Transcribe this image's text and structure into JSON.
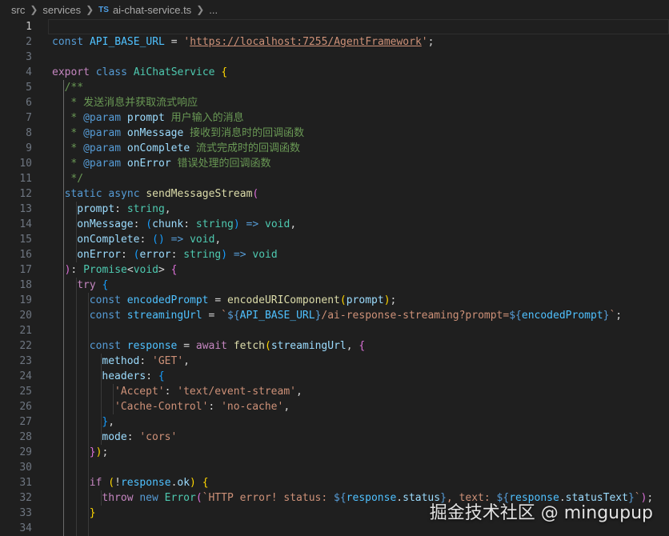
{
  "breadcrumb": {
    "items": [
      "src",
      "services"
    ],
    "file_icon": "TS",
    "file_name": "ai-chat-service.ts",
    "ellipsis": "..."
  },
  "editor": {
    "current_line": 1,
    "lines": [
      {
        "n": "1",
        "indent": 0,
        "tokens": []
      },
      {
        "n": "2",
        "indent": 0,
        "tokens": [
          [
            "kw",
            "const "
          ],
          [
            "cst",
            "API_BASE_URL"
          ],
          [
            "op",
            " = "
          ],
          [
            "str",
            "'"
          ],
          [
            "str link",
            "https://localhost:7255/AgentFramework"
          ],
          [
            "str",
            "'"
          ],
          [
            "pl",
            ";"
          ]
        ]
      },
      {
        "n": "3",
        "indent": 0,
        "tokens": []
      },
      {
        "n": "4",
        "indent": 0,
        "tokens": [
          [
            "ctl",
            "export "
          ],
          [
            "kw",
            "class "
          ],
          [
            "typ",
            "AiChatService "
          ],
          [
            "b1",
            "{"
          ]
        ]
      },
      {
        "n": "5",
        "indent": 1,
        "tokens": [
          [
            "cmt",
            "/**"
          ]
        ]
      },
      {
        "n": "6",
        "indent": 1,
        "tokens": [
          [
            "cmt",
            " * 发送消息并获取流式响应"
          ]
        ]
      },
      {
        "n": "7",
        "indent": 1,
        "tokens": [
          [
            "cmt",
            " * "
          ],
          [
            "kw",
            "@param "
          ],
          [
            "var",
            "prompt "
          ],
          [
            "cmt",
            "用户输入的消息"
          ]
        ]
      },
      {
        "n": "8",
        "indent": 1,
        "tokens": [
          [
            "cmt",
            " * "
          ],
          [
            "kw",
            "@param "
          ],
          [
            "var",
            "onMessage "
          ],
          [
            "cmt",
            "接收到消息时的回调函数"
          ]
        ]
      },
      {
        "n": "9",
        "indent": 1,
        "tokens": [
          [
            "cmt",
            " * "
          ],
          [
            "kw",
            "@param "
          ],
          [
            "var",
            "onComplete "
          ],
          [
            "cmt",
            "流式完成时的回调函数"
          ]
        ]
      },
      {
        "n": "10",
        "indent": 1,
        "tokens": [
          [
            "cmt",
            " * "
          ],
          [
            "kw",
            "@param "
          ],
          [
            "var",
            "onError "
          ],
          [
            "cmt",
            "错误处理的回调函数"
          ]
        ]
      },
      {
        "n": "11",
        "indent": 1,
        "tokens": [
          [
            "cmt",
            " */"
          ]
        ]
      },
      {
        "n": "12",
        "indent": 1,
        "tokens": [
          [
            "kw",
            "static "
          ],
          [
            "kw",
            "async "
          ],
          [
            "fn",
            "sendMessageStream"
          ],
          [
            "b2",
            "("
          ]
        ]
      },
      {
        "n": "13",
        "indent": 2,
        "tokens": [
          [
            "var",
            "prompt"
          ],
          [
            "pl",
            ": "
          ],
          [
            "typ",
            "string"
          ],
          [
            "pl",
            ","
          ]
        ]
      },
      {
        "n": "14",
        "indent": 2,
        "tokens": [
          [
            "var",
            "onMessage"
          ],
          [
            "pl",
            ": "
          ],
          [
            "b3",
            "("
          ],
          [
            "var",
            "chunk"
          ],
          [
            "pl",
            ": "
          ],
          [
            "typ",
            "string"
          ],
          [
            "b3",
            ")"
          ],
          [
            "kw",
            " => "
          ],
          [
            "typ",
            "void"
          ],
          [
            "pl",
            ","
          ]
        ]
      },
      {
        "n": "15",
        "indent": 2,
        "tokens": [
          [
            "var",
            "onComplete"
          ],
          [
            "pl",
            ": "
          ],
          [
            "b3",
            "()"
          ],
          [
            "kw",
            " => "
          ],
          [
            "typ",
            "void"
          ],
          [
            "pl",
            ","
          ]
        ]
      },
      {
        "n": "16",
        "indent": 2,
        "tokens": [
          [
            "var",
            "onError"
          ],
          [
            "pl",
            ": "
          ],
          [
            "b3",
            "("
          ],
          [
            "var",
            "error"
          ],
          [
            "pl",
            ": "
          ],
          [
            "typ",
            "string"
          ],
          [
            "b3",
            ")"
          ],
          [
            "kw",
            " => "
          ],
          [
            "typ",
            "void"
          ]
        ]
      },
      {
        "n": "17",
        "indent": 1,
        "tokens": [
          [
            "b2",
            ")"
          ],
          [
            "pl",
            ": "
          ],
          [
            "typ",
            "Promise"
          ],
          [
            "pl",
            "<"
          ],
          [
            "typ",
            "void"
          ],
          [
            "pl",
            "> "
          ],
          [
            "b2",
            "{"
          ]
        ]
      },
      {
        "n": "18",
        "indent": 2,
        "tokens": [
          [
            "ctl",
            "try "
          ],
          [
            "b3",
            "{"
          ]
        ]
      },
      {
        "n": "19",
        "indent": 3,
        "tokens": [
          [
            "kw",
            "const "
          ],
          [
            "cst",
            "encodedPrompt"
          ],
          [
            "op",
            " = "
          ],
          [
            "fn",
            "encodeURIComponent"
          ],
          [
            "b1",
            "("
          ],
          [
            "var",
            "prompt"
          ],
          [
            "b1",
            ")"
          ],
          [
            "pl",
            ";"
          ]
        ]
      },
      {
        "n": "20",
        "indent": 3,
        "tokens": [
          [
            "kw",
            "const "
          ],
          [
            "cst",
            "streamingUrl"
          ],
          [
            "op",
            " = "
          ],
          [
            "str",
            "`"
          ],
          [
            "kw",
            "${"
          ],
          [
            "cst",
            "API_BASE_URL"
          ],
          [
            "kw",
            "}"
          ],
          [
            "str",
            "/ai-response-streaming?prompt="
          ],
          [
            "kw",
            "${"
          ],
          [
            "cst",
            "encodedPrompt"
          ],
          [
            "kw",
            "}"
          ],
          [
            "str",
            "`"
          ],
          [
            "pl",
            ";"
          ]
        ]
      },
      {
        "n": "21",
        "indent": 3,
        "tokens": []
      },
      {
        "n": "22",
        "indent": 3,
        "tokens": [
          [
            "kw",
            "const "
          ],
          [
            "cst",
            "response"
          ],
          [
            "op",
            " = "
          ],
          [
            "ctl",
            "await "
          ],
          [
            "fn",
            "fetch"
          ],
          [
            "b1",
            "("
          ],
          [
            "var",
            "streamingUrl"
          ],
          [
            "pl",
            ", "
          ],
          [
            "b2",
            "{"
          ]
        ]
      },
      {
        "n": "23",
        "indent": 4,
        "tokens": [
          [
            "var",
            "method"
          ],
          [
            "pl",
            ": "
          ],
          [
            "str",
            "'GET'"
          ],
          [
            "pl",
            ","
          ]
        ]
      },
      {
        "n": "24",
        "indent": 4,
        "tokens": [
          [
            "var",
            "headers"
          ],
          [
            "pl",
            ": "
          ],
          [
            "b3",
            "{"
          ]
        ]
      },
      {
        "n": "25",
        "indent": 5,
        "tokens": [
          [
            "str",
            "'Accept'"
          ],
          [
            "pl",
            ": "
          ],
          [
            "str",
            "'text/event-stream'"
          ],
          [
            "pl",
            ","
          ]
        ]
      },
      {
        "n": "26",
        "indent": 5,
        "tokens": [
          [
            "str",
            "'Cache-Control'"
          ],
          [
            "pl",
            ": "
          ],
          [
            "str",
            "'no-cache'"
          ],
          [
            "pl",
            ","
          ]
        ]
      },
      {
        "n": "27",
        "indent": 4,
        "tokens": [
          [
            "b3",
            "}"
          ],
          [
            "pl",
            ","
          ]
        ]
      },
      {
        "n": "28",
        "indent": 4,
        "tokens": [
          [
            "var",
            "mode"
          ],
          [
            "pl",
            ": "
          ],
          [
            "str",
            "'cors'"
          ]
        ]
      },
      {
        "n": "29",
        "indent": 3,
        "tokens": [
          [
            "b2",
            "}"
          ],
          [
            "b1",
            ")"
          ],
          [
            "pl",
            ";"
          ]
        ]
      },
      {
        "n": "30",
        "indent": 3,
        "tokens": []
      },
      {
        "n": "31",
        "indent": 3,
        "tokens": [
          [
            "ctl",
            "if "
          ],
          [
            "b1",
            "("
          ],
          [
            "op",
            "!"
          ],
          [
            "cst",
            "response"
          ],
          [
            "pl",
            "."
          ],
          [
            "var",
            "ok"
          ],
          [
            "b1",
            ")"
          ],
          [
            "pl",
            " "
          ],
          [
            "b1",
            "{"
          ]
        ]
      },
      {
        "n": "32",
        "indent": 4,
        "tokens": [
          [
            "ctl",
            "throw "
          ],
          [
            "kw",
            "new "
          ],
          [
            "typ",
            "Error"
          ],
          [
            "b2",
            "("
          ],
          [
            "str",
            "`HTTP error! status: "
          ],
          [
            "kw",
            "${"
          ],
          [
            "cst",
            "response"
          ],
          [
            "pl",
            "."
          ],
          [
            "var",
            "status"
          ],
          [
            "kw",
            "}"
          ],
          [
            "str",
            ", text: "
          ],
          [
            "kw",
            "${"
          ],
          [
            "cst",
            "response"
          ],
          [
            "pl",
            "."
          ],
          [
            "var",
            "statusText"
          ],
          [
            "kw",
            "}"
          ],
          [
            "str",
            "`"
          ],
          [
            "b2",
            ")"
          ],
          [
            "pl",
            ";"
          ]
        ]
      },
      {
        "n": "33",
        "indent": 3,
        "tokens": [
          [
            "b1",
            "}"
          ]
        ]
      },
      {
        "n": "34",
        "indent": 3,
        "tokens": []
      }
    ]
  },
  "watermark": "掘金技术社区 @ mingupup"
}
